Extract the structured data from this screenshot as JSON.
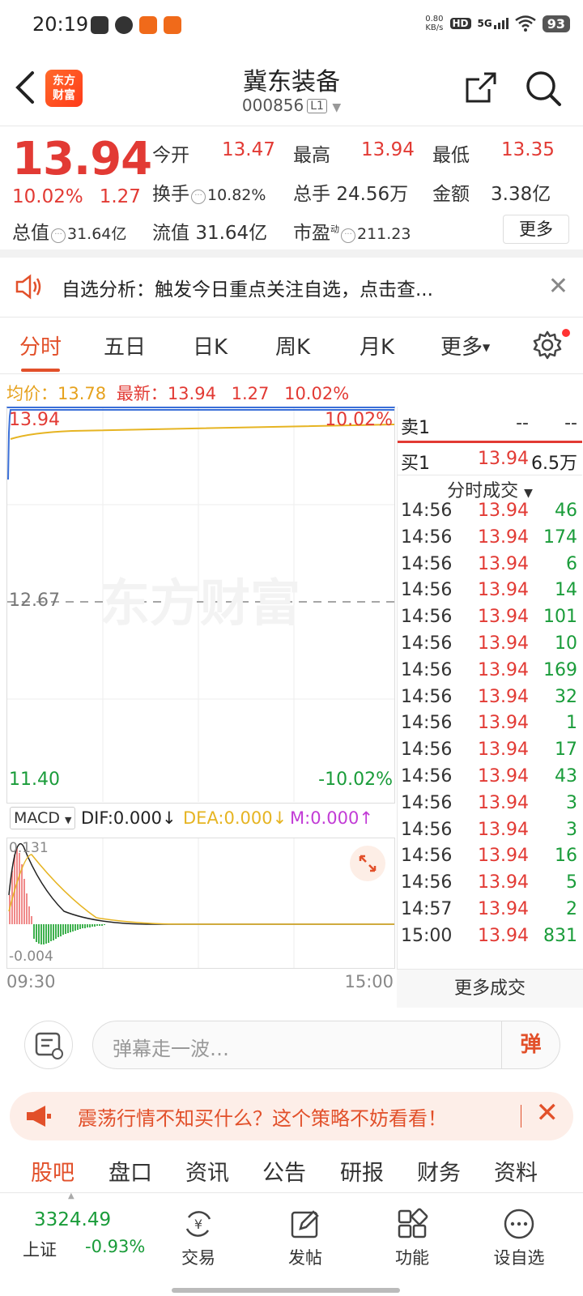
{
  "status_bar": {
    "time": "20:19",
    "net_speed_value": "0.80",
    "net_speed_unit": "KB/s",
    "hd": "HD",
    "signal": "5G",
    "battery": "93"
  },
  "header": {
    "stock_name": "冀东装备",
    "stock_code": "000856",
    "level": "L1",
    "logo_line1": "东方",
    "logo_line2": "财富"
  },
  "quote": {
    "price": "13.94",
    "change_pct": "10.02%",
    "change": "1.27",
    "open_label": "今开",
    "open": "13.47",
    "high_label": "最高",
    "high": "13.94",
    "low_label": "最低",
    "low": "13.35",
    "turnover_label": "换手",
    "turnover": "10.82%",
    "volume_label": "总手",
    "volume": "24.56万",
    "amount_label": "金额",
    "amount": "3.38亿",
    "mktcap_label": "总值",
    "mktcap": "31.64亿",
    "float_label": "流值",
    "float_cap": "31.64亿",
    "pe_label": "市盈",
    "pe_sup": "动",
    "pe": "211.23",
    "more": "更多"
  },
  "notice": {
    "text": "自选分析：触发今日重点关注自选，点击查..."
  },
  "tabs": {
    "items": [
      "分时",
      "五日",
      "日K",
      "周K",
      "月K",
      "更多"
    ],
    "active": 0
  },
  "info_line": {
    "avg_label": "均价：",
    "avg": "13.78",
    "latest_label": "最新：",
    "latest": "13.94",
    "change": "1.27",
    "pct": "10.02%"
  },
  "chart": {
    "top_price": "13.94",
    "top_pct": "10.02%",
    "mid_price": "12.67",
    "bottom_price": "11.40",
    "bottom_pct": "-10.02%",
    "watermark": "东方财富",
    "time_start": "09:30",
    "time_end": "15:00",
    "colors": {
      "price_line": "#3a6fd8",
      "avg_line": "#e6b422",
      "up": "#e23a34",
      "down": "#1a9c3a"
    }
  },
  "macd": {
    "selector": "MACD",
    "dif": "DIF:0.000",
    "dea": "DEA:0.000",
    "m": "M:0.000",
    "top": "0.131",
    "bottom": "-0.004"
  },
  "order_book": {
    "sell1_label": "卖1",
    "sell1_price": "--",
    "sell1_vol": "--",
    "buy1_label": "买1",
    "buy1_price": "13.94",
    "buy1_vol": "6.5万"
  },
  "ticks": {
    "header": "分时成交",
    "rows": [
      {
        "time": "14:56",
        "price": "13.94",
        "vol": "46"
      },
      {
        "time": "14:56",
        "price": "13.94",
        "vol": "174"
      },
      {
        "time": "14:56",
        "price": "13.94",
        "vol": "6"
      },
      {
        "time": "14:56",
        "price": "13.94",
        "vol": "14"
      },
      {
        "time": "14:56",
        "price": "13.94",
        "vol": "101"
      },
      {
        "time": "14:56",
        "price": "13.94",
        "vol": "10"
      },
      {
        "time": "14:56",
        "price": "13.94",
        "vol": "169"
      },
      {
        "time": "14:56",
        "price": "13.94",
        "vol": "32"
      },
      {
        "time": "14:56",
        "price": "13.94",
        "vol": "1"
      },
      {
        "time": "14:56",
        "price": "13.94",
        "vol": "17"
      },
      {
        "time": "14:56",
        "price": "13.94",
        "vol": "43"
      },
      {
        "time": "14:56",
        "price": "13.94",
        "vol": "3"
      },
      {
        "time": "14:56",
        "price": "13.94",
        "vol": "3"
      },
      {
        "time": "14:56",
        "price": "13.94",
        "vol": "16"
      },
      {
        "time": "14:56",
        "price": "13.94",
        "vol": "5"
      },
      {
        "time": "14:57",
        "price": "13.94",
        "vol": "2"
      },
      {
        "time": "15:00",
        "price": "13.94",
        "vol": "831"
      }
    ],
    "more": "更多成交"
  },
  "danmu": {
    "placeholder": "弹幕走一波…",
    "button": "弹"
  },
  "promo": {
    "text": "震荡行情不知买什么？这个策略不妨看看！"
  },
  "bottom_tabs": {
    "items": [
      "股吧",
      "盘口",
      "资讯",
      "公告",
      "研报",
      "财务",
      "资料"
    ],
    "active": 0
  },
  "bottom_bar": {
    "index_value": "3324.49",
    "index_name": "上证",
    "index_change": "-0.93%",
    "items": [
      "交易",
      "发帖",
      "功能",
      "设自选"
    ]
  }
}
